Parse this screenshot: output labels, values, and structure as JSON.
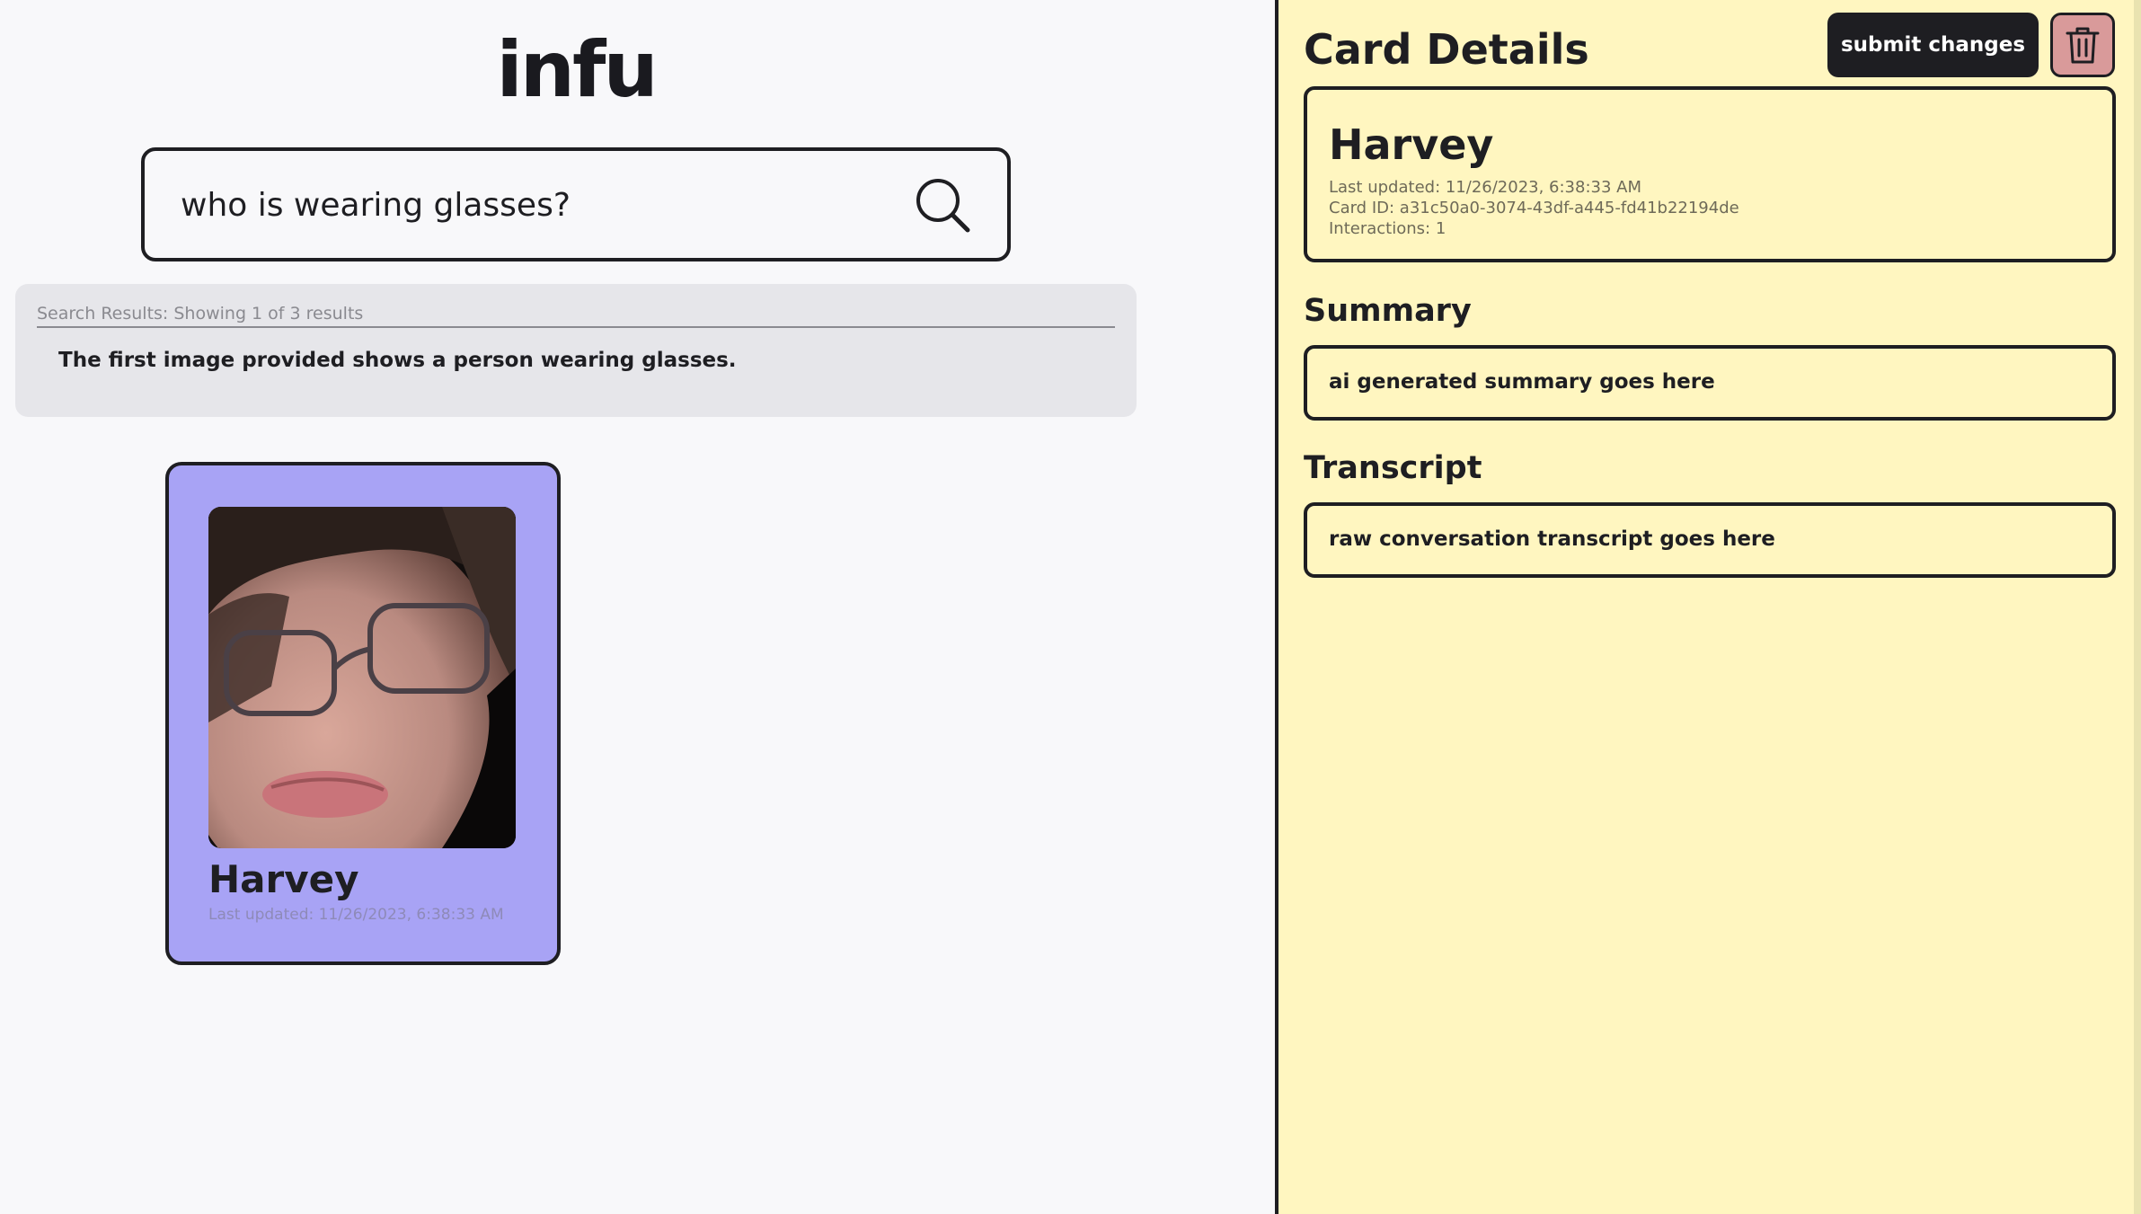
{
  "app": {
    "logo": "infu"
  },
  "search": {
    "value": "who is wearing glasses?",
    "icon": "search-icon"
  },
  "results": {
    "status": "Search Results: Showing 1 of 3 results",
    "answer": "The first image provided shows a person wearing glasses."
  },
  "cards": [
    {
      "name": "Harvey",
      "last_updated": "Last updated: 11/26/2023, 6:38:33 AM",
      "color": "#a8a3f5"
    }
  ],
  "details": {
    "title": "Card Details",
    "submit_label": "submit changes",
    "delete_icon": "trash-icon",
    "name": "Harvey",
    "last_updated": "Last updated: 11/26/2023, 6:38:33 AM",
    "card_id": "Card ID: a31c50a0-3074-43df-a445-fd41b22194de",
    "interactions": "Interactions: 1",
    "summary_heading": "Summary",
    "summary_value": "ai generated summary goes here",
    "transcript_heading": "Transcript",
    "transcript_value": "raw conversation transcript goes here"
  },
  "colors": {
    "panel_bg": "#fff6c0",
    "card_bg": "#a8a3f5",
    "delete_bg": "#d99a9a",
    "dark": "#1e1e22"
  }
}
